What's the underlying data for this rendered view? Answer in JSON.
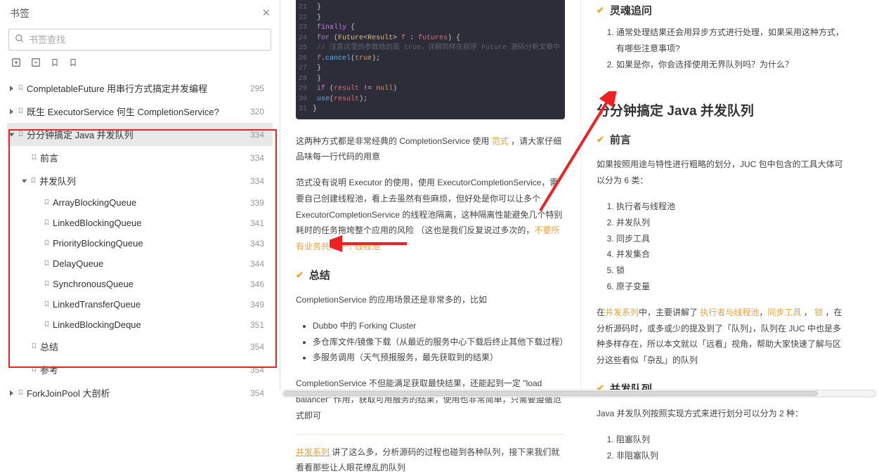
{
  "sidebar": {
    "title": "书签",
    "search_placeholder": "书签查找",
    "items": [
      {
        "label": "CompletableFuture 用串行方式搞定并发编程",
        "page": 295,
        "depth": 0,
        "caret": true,
        "open": false
      },
      {
        "label": "既生 ExecutorService 何生 CompletionService?",
        "page": 320,
        "depth": 0,
        "caret": true,
        "open": false
      },
      {
        "label": "分分钟搞定 Java 并发队列",
        "page": 334,
        "depth": 0,
        "caret": true,
        "open": true,
        "selected": true
      },
      {
        "label": "前言",
        "page": 334,
        "depth": 1,
        "caret": false
      },
      {
        "label": "并发队列",
        "page": 334,
        "depth": 1,
        "caret": true,
        "open": true
      },
      {
        "label": "ArrayBlockingQueue",
        "page": 339,
        "depth": 2,
        "caret": false
      },
      {
        "label": "LinkedBlockingQueue",
        "page": 341,
        "depth": 2,
        "caret": false
      },
      {
        "label": "PriorityBlockingQueue",
        "page": 343,
        "depth": 2,
        "caret": false
      },
      {
        "label": "DelayQueue",
        "page": 344,
        "depth": 2,
        "caret": false
      },
      {
        "label": "SynchronousQueue",
        "page": 346,
        "depth": 2,
        "caret": false
      },
      {
        "label": "LinkedTransferQueue",
        "page": 349,
        "depth": 2,
        "caret": false
      },
      {
        "label": "LinkedBlockingDeque",
        "page": 351,
        "depth": 2,
        "caret": false
      },
      {
        "label": "总结",
        "page": 354,
        "depth": 1,
        "caret": false
      },
      {
        "label": "参考",
        "page": 354,
        "depth": 1,
        "caret": false
      },
      {
        "label": "ForkJoinPool 大剖析",
        "page": 354,
        "depth": 0,
        "caret": true,
        "open": false
      }
    ]
  },
  "code": {
    "lines": [
      {
        "n": 21,
        "html": "        }"
      },
      {
        "n": 22,
        "html": "    }"
      },
      {
        "n": 23,
        "html": "    <span class='kw'>finally</span> {"
      },
      {
        "n": 24,
        "html": "        <span class='kw'>for</span> (<span class='ty'>Future</span>&lt;<span class='ty'>Result</span>&gt; <span class='var'>f</span> : <span class='var'>futures</span>) {"
      },
      {
        "n": 25,
        "html": "            <span class='cm'>// 注意这里的参数给的是 true，详解同样在前序 Future 源码分析文章中</span>"
      },
      {
        "n": 26,
        "html": "            <span class='var'>f</span>.<span class='fn'>cancel</span>(<span class='tr'>true</span>);"
      },
      {
        "n": 27,
        "html": "        }"
      },
      {
        "n": 28,
        "html": "    }"
      },
      {
        "n": 29,
        "html": "    <span class='kw'>if</span> (<span class='var'>result</span> != <span class='tr'>null</span>)"
      },
      {
        "n": 30,
        "html": "        <span class='fn'>use</span>(<span class='var'>result</span>);"
      },
      {
        "n": 31,
        "html": "}"
      }
    ]
  },
  "left": {
    "p1a": "这两种方式都是非常经典的 CompletionService 使用 ",
    "p1o": "范式",
    "p1b": " ，请大家仔细品味每一行代码的用意",
    "p2a": "范式没有说明 Executor 的使用，使用 ExecutorCompletionService，需要自己创建线程池，看上去虽然有些麻烦，但好处是你可以让多个 ExecutorCompletionService 的线程池隔离，这种隔离性能避免几个特别耗时的任务拖垮整个应用的风险 （这也是我们反复说过多次的，",
    "p2o": "不要所有业务共用一个线程池",
    "sec_title": "总结",
    "p3": "CompletionService 的应用场景还是非常多的，比如",
    "bullets": [
      "Dubbo 中的 Forking Cluster",
      "多仓库文件/镜像下载（从最近的服务中心下载后终止其他下载过程）",
      "多服务调用（天气预报服务，最先获取到的结果）"
    ],
    "p4": "CompletionService 不但能满足获取最快结果，还能起到一定 \"load balancer\" 作用，获取可用服务的结果，使用也非常简单，只需要遵循范式即可",
    "p5a": "并发系列",
    "p5b": " 讲了这么多，分析源码的过程也碰到各种队列，接下来我们就看看那些让人眼花缭乱的队列"
  },
  "right": {
    "soul_title": "灵魂追问",
    "soul_q": [
      "通常处理结果还会用异步方式进行处理，如果采用这种方式，有哪些注意事项?",
      "如果是你，你会选择使用无界队列吗？为什么？"
    ],
    "big_title": "分分钟搞定 Java 并发队列",
    "preface_title": "前言",
    "preface_p": "如果按照用途与特性进行粗略的划分，JUC 包中包含的工具大体可以分为 6 类：",
    "cat": [
      "执行者与线程池",
      "并发队列",
      "同步工具",
      "并发集合",
      "锁",
      "原子变量"
    ],
    "p_mid_a": "在",
    "p_mid_b": "并发系列",
    "p_mid_c": "中，主要讲解了 ",
    "p_mid_d": "执行者与线程池",
    "p_mid_e": "，",
    "p_mid_f": "同步工具",
    "p_mid_g": " ， ",
    "p_mid_h": "锁",
    "p_mid_i": " ，在分析源码时，或多或少的提及到了「队列」，队列在 JUC 中也是多种多样存在，所以本文就以「远看」视角，帮助大家快速了解与区分这些看似「杂乱」的队列",
    "queue_title": "并发队列",
    "queue_p": "Java 并发队列按照实现方式来进行划分可以分为 2 种：",
    "queue_types": [
      "阻塞队列",
      "非阻塞队列"
    ]
  }
}
